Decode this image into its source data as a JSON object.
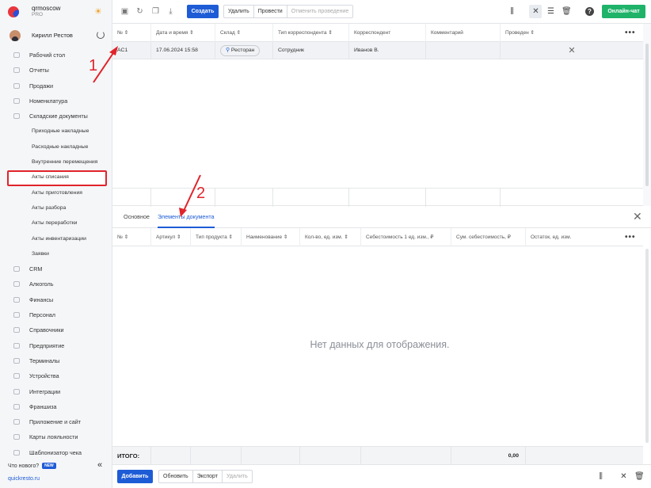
{
  "brand": {
    "name": "qrmoscow",
    "plan": "PRO"
  },
  "user": {
    "name": "Кирилл Рестов"
  },
  "nav": [
    {
      "label": "Рабочий стол",
      "sub": false
    },
    {
      "label": "Отчеты",
      "sub": false
    },
    {
      "label": "Продажи",
      "sub": false
    },
    {
      "label": "Номенклатура",
      "sub": false
    },
    {
      "label": "Складские документы",
      "sub": false
    },
    {
      "label": "Приходные накладные",
      "sub": true
    },
    {
      "label": "Расходные накладные",
      "sub": true
    },
    {
      "label": "Внутренние перемещения",
      "sub": true
    },
    {
      "label": "Акты списания",
      "sub": true,
      "active": true
    },
    {
      "label": "Акты приготовления",
      "sub": true
    },
    {
      "label": "Акты разбора",
      "sub": true
    },
    {
      "label": "Акты переработки",
      "sub": true
    },
    {
      "label": "Акты инвентаризации",
      "sub": true
    },
    {
      "label": "Заявки",
      "sub": true
    },
    {
      "label": "CRM",
      "sub": false
    },
    {
      "label": "Алкоголь",
      "sub": false
    },
    {
      "label": "Финансы",
      "sub": false
    },
    {
      "label": "Персонал",
      "sub": false
    },
    {
      "label": "Справочники",
      "sub": false
    },
    {
      "label": "Предприятие",
      "sub": false
    },
    {
      "label": "Терминалы",
      "sub": false
    },
    {
      "label": "Устройства",
      "sub": false
    },
    {
      "label": "Интеграции",
      "sub": false
    },
    {
      "label": "Франшиза",
      "sub": false
    },
    {
      "label": "Приложение и сайт",
      "sub": false
    },
    {
      "label": "Карты лояльности",
      "sub": false
    },
    {
      "label": "Шаблонизатор чека",
      "sub": false
    }
  ],
  "footer": {
    "whats_new": "Что нового?",
    "new_badge": "NEW",
    "site": "quickresto.ru",
    "collapse": "«"
  },
  "toolbar": {
    "create": "Создать",
    "delete": "Удалить",
    "post": "Провести",
    "unpost": "Отменить проведение",
    "chat": "Онлайн-чат"
  },
  "grid": {
    "columns": [
      "№ ⇕",
      "Дата и время ⇕",
      "Склад ⇕",
      "Тип корреспондента ⇕",
      "Корреспондент",
      "Комментарий",
      "Проведен ⇕"
    ],
    "row": {
      "number": "AC1",
      "datetime": "17.06.2024 15:58",
      "warehouse": "Ресторан",
      "corr_type": "Сотрудник",
      "correspondent": "Иванов В.",
      "comment": "",
      "posted": "✕"
    },
    "more": "•••"
  },
  "tabs": {
    "main": "Основное",
    "elements": "Элементы документа",
    "close": "✕"
  },
  "detail": {
    "columns": [
      "№ ⇕",
      "Артикул ⇕",
      "Тип продукта ⇕",
      "Наименование ⇕",
      "Кол-во, ед. изм. ⇕",
      "Себестоимость 1 ед. изм., ₽",
      "Сум. себестоимость, ₽",
      "Остаток, ед. изм."
    ],
    "empty": "Нет данных для отображения.",
    "total_label": "ИТОГО:",
    "total_value": "0,00",
    "more": "•••"
  },
  "bottom": {
    "add": "Добавить",
    "refresh": "Обновить",
    "export": "Экспорт",
    "delete": "Удалить"
  },
  "annotations": {
    "one": "1",
    "two": "2"
  },
  "colors": {
    "accent": "#1e5cd6",
    "chat": "#1fb36a",
    "annotation": "#e0242b"
  }
}
